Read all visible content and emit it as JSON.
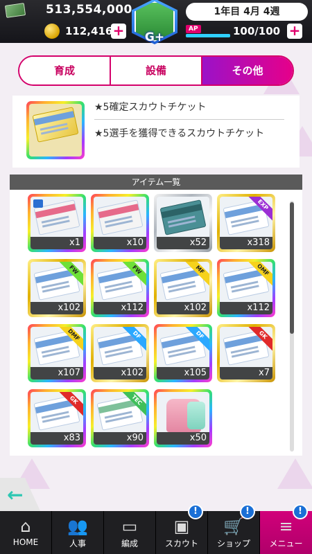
{
  "header": {
    "money": "513,554,000",
    "coins": "112,416",
    "rank": "G+",
    "date": "1年目 4月 4週",
    "ap_label": "AP",
    "ap_value": "100/100",
    "ap_fraction": 1.0,
    "plus": "+"
  },
  "tabs": [
    {
      "label": "育成",
      "active": false
    },
    {
      "label": "設備",
      "active": false
    },
    {
      "label": "その他",
      "active": true
    }
  ],
  "selected_item": {
    "name": "★5確定スカウトチケット",
    "description": "★5選手を獲得できるスカウトチケット"
  },
  "list": {
    "title": "アイテム一覧",
    "items": [
      {
        "count": "x1",
        "frame": "rainbow",
        "tag": ""
      },
      {
        "count": "x10",
        "frame": "rainbow",
        "tag": ""
      },
      {
        "count": "x52",
        "frame": "silver",
        "tag": ""
      },
      {
        "count": "x318",
        "frame": "gold",
        "tag": "EXP"
      },
      {
        "count": "x102",
        "frame": "gold",
        "tag": "FW"
      },
      {
        "count": "x112",
        "frame": "rainbow",
        "tag": "FW"
      },
      {
        "count": "x102",
        "frame": "gold",
        "tag": "MF"
      },
      {
        "count": "x112",
        "frame": "rainbow",
        "tag": "OMF"
      },
      {
        "count": "x107",
        "frame": "rainbow",
        "tag": "DMF"
      },
      {
        "count": "x102",
        "frame": "gold",
        "tag": "DF"
      },
      {
        "count": "x105",
        "frame": "rainbow",
        "tag": "DF"
      },
      {
        "count": "x7",
        "frame": "gold",
        "tag": "GK"
      },
      {
        "count": "x83",
        "frame": "rainbow",
        "tag": "GK"
      },
      {
        "count": "x90",
        "frame": "rainbow",
        "tag": "TEC"
      },
      {
        "count": "x50",
        "frame": "rainbow",
        "tag": ""
      }
    ]
  },
  "nav": [
    {
      "label": "HOME",
      "icon": "home-icon",
      "badge": "",
      "active": false
    },
    {
      "label": "人事",
      "icon": "people-icon",
      "badge": "",
      "active": false
    },
    {
      "label": "編成",
      "icon": "field-icon",
      "badge": "",
      "active": false
    },
    {
      "label": "スカウト",
      "icon": "scout-icon",
      "badge": "!",
      "active": false
    },
    {
      "label": "ショップ",
      "icon": "cart-icon",
      "badge": "!",
      "active": false
    },
    {
      "label": "メニュー",
      "icon": "menu-icon",
      "badge": "!",
      "active": true
    }
  ],
  "colors": {
    "accent": "#d4006b",
    "tab_active_start": "#9b12c8",
    "tab_active_end": "#e6008a",
    "ap_bar": "#2fd0ff",
    "back_arrow": "#2cc7b2"
  }
}
